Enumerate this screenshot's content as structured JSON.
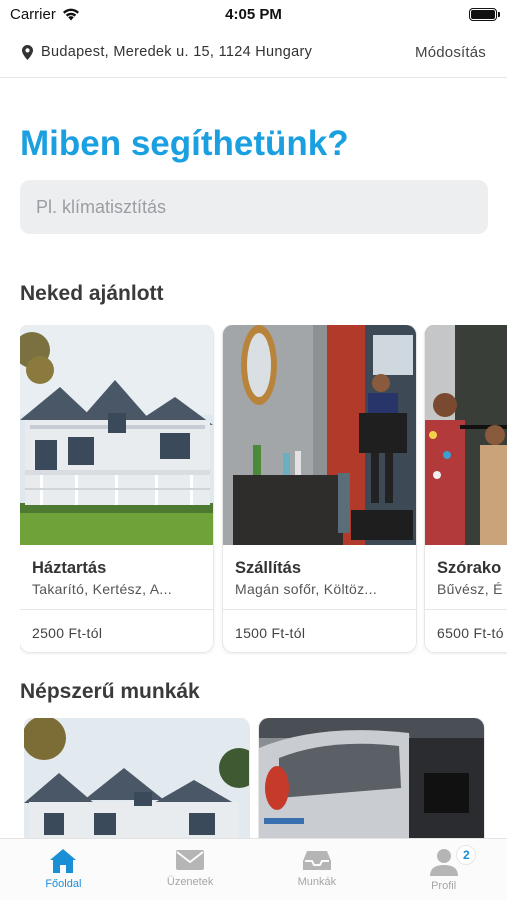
{
  "status_bar": {
    "carrier": "Carrier",
    "time": "4:05 PM"
  },
  "location": {
    "address": "Budapest, Meredek u. 15, 1124 Hungary",
    "edit_label": "Módosítás"
  },
  "title": "Miben segíthetünk?",
  "search": {
    "placeholder": "Pl. klímatisztítás",
    "value": ""
  },
  "recommended": {
    "heading": "Neked ajánlott",
    "cards": [
      {
        "title": "Háztartás",
        "subtitle": "Takarító, Kertész, A...",
        "price": "2500 Ft-tól",
        "image": "house"
      },
      {
        "title": "Szállítás",
        "subtitle": "Magán sofőr, Költöz...",
        "price": "1500 Ft-tól",
        "image": "moving"
      },
      {
        "title": "Szórako",
        "subtitle": "Bűvész, É",
        "price": "6500 Ft-tó",
        "image": "party"
      }
    ]
  },
  "popular": {
    "heading": "Népszerű munkák",
    "cards": [
      {
        "image": "house"
      },
      {
        "image": "car-repair"
      }
    ]
  },
  "tabs": [
    {
      "label": "Főoldal",
      "icon": "home-icon",
      "active": true
    },
    {
      "label": "Üzenetek",
      "icon": "mail-icon",
      "active": false
    },
    {
      "label": "Munkák",
      "icon": "inbox-icon",
      "active": false
    },
    {
      "label": "Profil",
      "icon": "person-icon",
      "active": false,
      "badge": "2"
    }
  ],
  "colors": {
    "accent": "#1aa0e0",
    "tab_active": "#1a8fd6",
    "tab_inactive": "#a6a6a6"
  }
}
